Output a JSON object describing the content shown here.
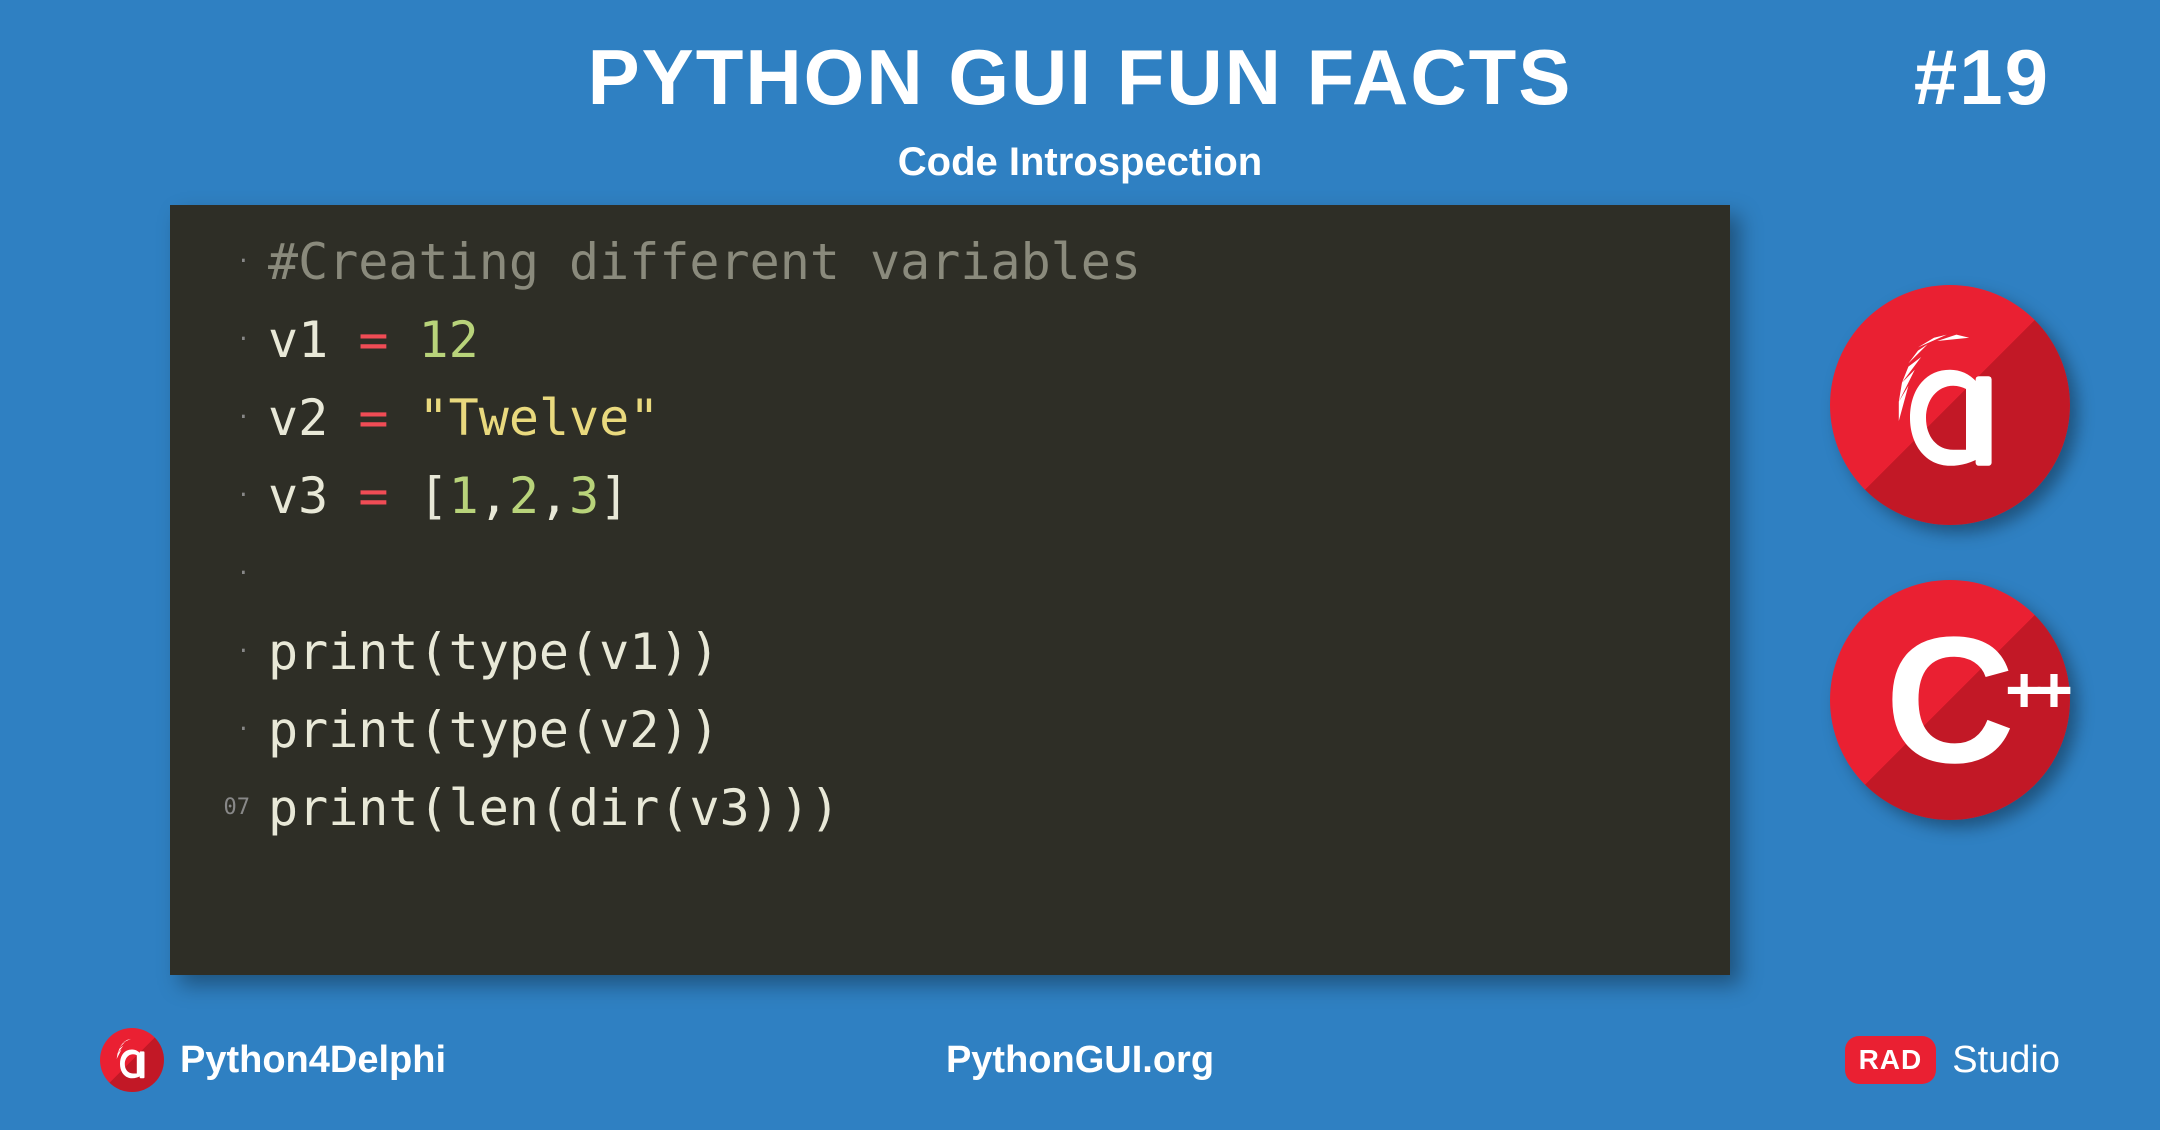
{
  "header": {
    "title": "PYTHON GUI FUN FACTS",
    "issue": "#19",
    "subtitle": "Code Introspection"
  },
  "code": {
    "lines": [
      {
        "gutter": "·",
        "tokens": [
          {
            "cls": "c-comment",
            "t": "#Creating different variables"
          }
        ]
      },
      {
        "gutter": "·",
        "tokens": [
          {
            "cls": "c-var",
            "t": "v1 "
          },
          {
            "cls": "c-op",
            "t": "="
          },
          {
            "cls": "c-var",
            "t": " "
          },
          {
            "cls": "c-num",
            "t": "12"
          }
        ]
      },
      {
        "gutter": "·",
        "tokens": [
          {
            "cls": "c-var",
            "t": "v2 "
          },
          {
            "cls": "c-op",
            "t": "="
          },
          {
            "cls": "c-var",
            "t": " "
          },
          {
            "cls": "c-str",
            "t": "\"Twelve\""
          }
        ]
      },
      {
        "gutter": "·",
        "tokens": [
          {
            "cls": "c-var",
            "t": "v3 "
          },
          {
            "cls": "c-op",
            "t": "="
          },
          {
            "cls": "c-var",
            "t": " "
          },
          {
            "cls": "c-bracket",
            "t": "["
          },
          {
            "cls": "c-num",
            "t": "1"
          },
          {
            "cls": "c-comma",
            "t": ","
          },
          {
            "cls": "c-num",
            "t": "2"
          },
          {
            "cls": "c-comma",
            "t": ","
          },
          {
            "cls": "c-num",
            "t": "3"
          },
          {
            "cls": "c-bracket",
            "t": "]"
          }
        ]
      },
      {
        "gutter": "·",
        "tokens": []
      },
      {
        "gutter": "·",
        "tokens": [
          {
            "cls": "c-func",
            "t": "print"
          },
          {
            "cls": "c-paren",
            "t": "("
          },
          {
            "cls": "c-func",
            "t": "type"
          },
          {
            "cls": "c-paren",
            "t": "("
          },
          {
            "cls": "c-var",
            "t": "v1"
          },
          {
            "cls": "c-paren",
            "t": "))"
          }
        ]
      },
      {
        "gutter": "·",
        "tokens": [
          {
            "cls": "c-func",
            "t": "print"
          },
          {
            "cls": "c-paren",
            "t": "("
          },
          {
            "cls": "c-func",
            "t": "type"
          },
          {
            "cls": "c-paren",
            "t": "("
          },
          {
            "cls": "c-var",
            "t": "v2"
          },
          {
            "cls": "c-paren",
            "t": "))"
          }
        ]
      },
      {
        "gutter": "07",
        "tokens": [
          {
            "cls": "c-func",
            "t": "print"
          },
          {
            "cls": "c-paren",
            "t": "("
          },
          {
            "cls": "c-func",
            "t": "len"
          },
          {
            "cls": "c-paren",
            "t": "("
          },
          {
            "cls": "c-func",
            "t": "dir"
          },
          {
            "cls": "c-paren",
            "t": "("
          },
          {
            "cls": "c-var",
            "t": "v3"
          },
          {
            "cls": "c-paren",
            "t": ")))"
          }
        ]
      }
    ]
  },
  "logos": {
    "cpp": {
      "c": "C",
      "pp": "++"
    }
  },
  "footer": {
    "left": "Python4Delphi",
    "center": "PythonGUI.org",
    "rad": "RAD",
    "studio": "Studio"
  }
}
